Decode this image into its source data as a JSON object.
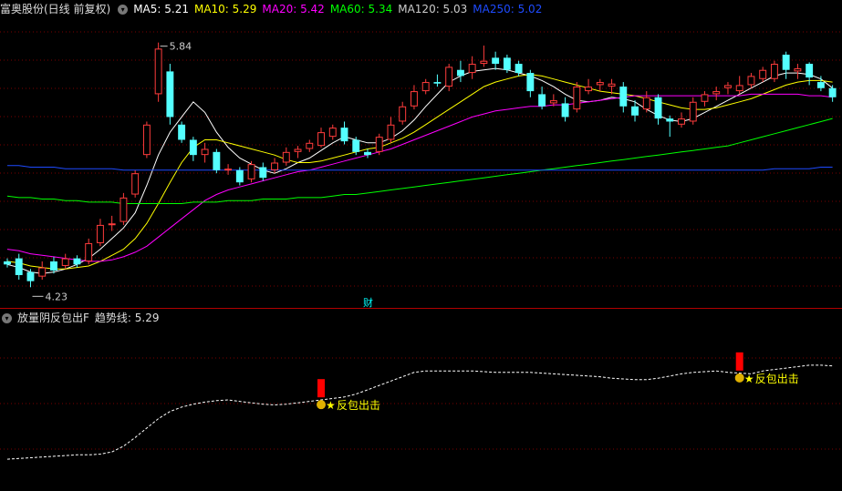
{
  "header": {
    "stock_title": "富奥股份(日线 前复权)",
    "ma_items": [
      {
        "label": "MA5: 5.21",
        "color": "#ffffff"
      },
      {
        "label": "MA10: 5.29",
        "color": "#ffff00"
      },
      {
        "label": "MA20: 5.42",
        "color": "#ff00ff"
      },
      {
        "label": "MA60: 5.34",
        "color": "#00ff00"
      },
      {
        "label": "MA120: 5.03",
        "color": "#cccccc"
      },
      {
        "label": "MA250: 5.02",
        "color": "#1e4bff"
      }
    ]
  },
  "indicator_header": {
    "title": "放量阴反包出F",
    "trend_label": "趋势线: 5.29"
  },
  "colors": {
    "up": "#ff3c3c",
    "down": "#54ffff",
    "grid": "#7a0000",
    "signal": "#ff0000",
    "signal_text": "#ffff00"
  },
  "chart_data": {
    "type": "candlestick",
    "ylim": [
      4.1,
      6.0
    ],
    "high_label": "5.84",
    "low_label": "4.23",
    "finance_marker": "财",
    "signal_text": "反包出击",
    "candles": [
      [
        4.4,
        4.38,
        4.42,
        4.36
      ],
      [
        4.42,
        4.31,
        4.45,
        4.28
      ],
      [
        4.33,
        4.27,
        4.35,
        4.23
      ],
      [
        4.3,
        4.36,
        4.4,
        4.28
      ],
      [
        4.4,
        4.34,
        4.43,
        4.32
      ],
      [
        4.37,
        4.42,
        4.45,
        4.35
      ],
      [
        4.42,
        4.38,
        4.44,
        4.36
      ],
      [
        4.4,
        4.52,
        4.55,
        4.38
      ],
      [
        4.52,
        4.64,
        4.68,
        4.5
      ],
      [
        4.64,
        4.65,
        4.7,
        4.6
      ],
      [
        4.66,
        4.82,
        4.85,
        4.64
      ],
      [
        4.84,
        4.98,
        5.0,
        4.82
      ],
      [
        5.1,
        5.3,
        5.32,
        5.08
      ],
      [
        5.5,
        5.8,
        5.84,
        5.45
      ],
      [
        5.65,
        5.35,
        5.7,
        5.3
      ],
      [
        5.3,
        5.2,
        5.32,
        5.18
      ],
      [
        5.2,
        5.1,
        5.22,
        5.06
      ],
      [
        5.1,
        5.14,
        5.18,
        5.05
      ],
      [
        5.12,
        5.0,
        5.14,
        4.98
      ],
      [
        5.0,
        5.01,
        5.04,
        4.97
      ],
      [
        5.0,
        4.92,
        5.02,
        4.9
      ],
      [
        4.94,
        5.04,
        5.06,
        4.92
      ],
      [
        5.02,
        4.95,
        5.05,
        4.93
      ],
      [
        5.0,
        5.05,
        5.08,
        4.98
      ],
      [
        5.05,
        5.12,
        5.15,
        5.03
      ],
      [
        5.12,
        5.14,
        5.16,
        5.08
      ],
      [
        5.14,
        5.18,
        5.2,
        5.12
      ],
      [
        5.16,
        5.25,
        5.28,
        5.15
      ],
      [
        5.22,
        5.28,
        5.3,
        5.2
      ],
      [
        5.28,
        5.19,
        5.32,
        5.17
      ],
      [
        5.2,
        5.12,
        5.22,
        5.1
      ],
      [
        5.12,
        5.1,
        5.14,
        5.08
      ],
      [
        5.12,
        5.22,
        5.24,
        5.1
      ],
      [
        5.2,
        5.3,
        5.35,
        5.18
      ],
      [
        5.32,
        5.42,
        5.45,
        5.3
      ],
      [
        5.42,
        5.52,
        5.56,
        5.4
      ],
      [
        5.52,
        5.58,
        5.6,
        5.5
      ],
      [
        5.58,
        5.57,
        5.63,
        5.55
      ],
      [
        5.55,
        5.68,
        5.7,
        5.52
      ],
      [
        5.66,
        5.62,
        5.72,
        5.58
      ],
      [
        5.64,
        5.7,
        5.75,
        5.6
      ],
      [
        5.7,
        5.72,
        5.82,
        5.68
      ],
      [
        5.74,
        5.7,
        5.78,
        5.66
      ],
      [
        5.74,
        5.66,
        5.76,
        5.64
      ],
      [
        5.7,
        5.64,
        5.72,
        5.62
      ],
      [
        5.64,
        5.52,
        5.66,
        5.48
      ],
      [
        5.5,
        5.42,
        5.55,
        5.4
      ],
      [
        5.44,
        5.46,
        5.5,
        5.42
      ],
      [
        5.44,
        5.35,
        5.48,
        5.32
      ],
      [
        5.4,
        5.55,
        5.58,
        5.38
      ],
      [
        5.52,
        5.55,
        5.6,
        5.5
      ],
      [
        5.56,
        5.58,
        5.6,
        5.52
      ],
      [
        5.55,
        5.57,
        5.6,
        5.5
      ],
      [
        5.55,
        5.42,
        5.58,
        5.38
      ],
      [
        5.42,
        5.36,
        5.46,
        5.32
      ],
      [
        5.4,
        5.48,
        5.52,
        5.38
      ],
      [
        5.48,
        5.34,
        5.5,
        5.3
      ],
      [
        5.34,
        5.32,
        5.36,
        5.22
      ],
      [
        5.3,
        5.34,
        5.38,
        5.28
      ],
      [
        5.32,
        5.45,
        5.48,
        5.3
      ],
      [
        5.45,
        5.5,
        5.52,
        5.42
      ],
      [
        5.5,
        5.52,
        5.55,
        5.46
      ],
      [
        5.54,
        5.56,
        5.58,
        5.5
      ],
      [
        5.52,
        5.56,
        5.62,
        5.5
      ],
      [
        5.56,
        5.62,
        5.64,
        5.54
      ],
      [
        5.6,
        5.66,
        5.68,
        5.58
      ],
      [
        5.6,
        5.7,
        5.72,
        5.58
      ],
      [
        5.76,
        5.66,
        5.78,
        5.6
      ],
      [
        5.65,
        5.67,
        5.7,
        5.6
      ],
      [
        5.7,
        5.61,
        5.71,
        5.56
      ],
      [
        5.58,
        5.54,
        5.62,
        5.52
      ],
      [
        5.54,
        5.48,
        5.56,
        5.45
      ]
    ],
    "ma_lines": [
      {
        "name": "MA5",
        "color": "#ffffff",
        "values": [
          4.38,
          4.36,
          4.33,
          4.32,
          4.33,
          4.35,
          4.38,
          4.42,
          4.48,
          4.55,
          4.62,
          4.72,
          4.9,
          5.1,
          5.25,
          5.35,
          5.45,
          5.38,
          5.25,
          5.15,
          5.08,
          5.04,
          5.0,
          4.98,
          5.01,
          5.05,
          5.08,
          5.13,
          5.18,
          5.22,
          5.2,
          5.18,
          5.18,
          5.21,
          5.26,
          5.33,
          5.42,
          5.5,
          5.58,
          5.62,
          5.65,
          5.66,
          5.67,
          5.66,
          5.64,
          5.62,
          5.59,
          5.55,
          5.5,
          5.46,
          5.45,
          5.46,
          5.48,
          5.47,
          5.45,
          5.4,
          5.36,
          5.33,
          5.32,
          5.34,
          5.38,
          5.42,
          5.46,
          5.5,
          5.54,
          5.58,
          5.62,
          5.64,
          5.64,
          5.63,
          5.6,
          5.54
        ]
      },
      {
        "name": "MA10",
        "color": "#ffff00",
        "values": [
          4.4,
          4.39,
          4.37,
          4.36,
          4.35,
          4.35,
          4.36,
          4.37,
          4.4,
          4.44,
          4.48,
          4.55,
          4.65,
          4.78,
          4.92,
          5.05,
          5.15,
          5.2,
          5.2,
          5.18,
          5.16,
          5.14,
          5.12,
          5.1,
          5.07,
          5.05,
          5.05,
          5.06,
          5.08,
          5.1,
          5.12,
          5.14,
          5.15,
          5.18,
          5.21,
          5.25,
          5.3,
          5.35,
          5.4,
          5.45,
          5.5,
          5.55,
          5.58,
          5.6,
          5.62,
          5.63,
          5.62,
          5.6,
          5.58,
          5.56,
          5.54,
          5.52,
          5.51,
          5.5,
          5.49,
          5.47,
          5.45,
          5.43,
          5.41,
          5.4,
          5.4,
          5.41,
          5.43,
          5.45,
          5.47,
          5.5,
          5.53,
          5.56,
          5.58,
          5.59,
          5.59,
          5.58
        ]
      },
      {
        "name": "MA20",
        "color": "#ff00ff",
        "values": [
          4.48,
          4.47,
          4.45,
          4.44,
          4.43,
          4.42,
          4.41,
          4.4,
          4.4,
          4.41,
          4.43,
          4.46,
          4.5,
          4.56,
          4.62,
          4.68,
          4.74,
          4.8,
          4.84,
          4.87,
          4.89,
          4.91,
          4.93,
          4.95,
          4.97,
          4.99,
          5.0,
          5.02,
          5.04,
          5.06,
          5.08,
          5.1,
          5.12,
          5.14,
          5.17,
          5.2,
          5.23,
          5.26,
          5.29,
          5.32,
          5.35,
          5.37,
          5.39,
          5.4,
          5.41,
          5.42,
          5.42,
          5.43,
          5.43,
          5.44,
          5.45,
          5.46,
          5.47,
          5.48,
          5.49,
          5.49,
          5.49,
          5.49,
          5.49,
          5.49,
          5.49,
          5.49,
          5.49,
          5.49,
          5.5,
          5.5,
          5.5,
          5.5,
          5.5,
          5.49,
          5.49,
          5.48
        ]
      },
      {
        "name": "MA60",
        "color": "#00ff00",
        "values": [
          4.83,
          4.82,
          4.82,
          4.81,
          4.81,
          4.8,
          4.8,
          4.79,
          4.79,
          4.79,
          4.78,
          4.78,
          4.78,
          4.78,
          4.78,
          4.78,
          4.79,
          4.79,
          4.79,
          4.8,
          4.8,
          4.8,
          4.81,
          4.81,
          4.81,
          4.82,
          4.82,
          4.82,
          4.83,
          4.84,
          4.84,
          4.85,
          4.86,
          4.87,
          4.88,
          4.89,
          4.9,
          4.91,
          4.92,
          4.93,
          4.94,
          4.95,
          4.96,
          4.97,
          4.98,
          4.99,
          5.0,
          5.01,
          5.02,
          5.03,
          5.04,
          5.05,
          5.06,
          5.07,
          5.08,
          5.09,
          5.1,
          5.11,
          5.12,
          5.13,
          5.14,
          5.15,
          5.16,
          5.18,
          5.2,
          5.22,
          5.24,
          5.26,
          5.28,
          5.3,
          5.32,
          5.34
        ]
      },
      {
        "name": "MA250",
        "color": "#1e4bff",
        "values": [
          5.03,
          5.03,
          5.02,
          5.02,
          5.02,
          5.01,
          5.01,
          5.01,
          5.01,
          5.01,
          5.0,
          5.0,
          5.0,
          5.0,
          5.0,
          5.0,
          5.0,
          5.0,
          5.0,
          5.0,
          5.0,
          5.0,
          5.0,
          5.0,
          5.0,
          5.0,
          5.0,
          5.0,
          5.0,
          5.0,
          5.0,
          5.0,
          5.0,
          5.0,
          5.0,
          5.0,
          5.0,
          5.0,
          5.0,
          5.0,
          5.0,
          5.0,
          5.0,
          5.0,
          5.0,
          5.0,
          5.0,
          5.0,
          5.0,
          5.0,
          5.0,
          5.0,
          5.0,
          5.0,
          5.0,
          5.0,
          5.0,
          5.0,
          5.0,
          5.0,
          5.0,
          5.0,
          5.0,
          5.0,
          5.0,
          5.0,
          5.01,
          5.01,
          5.01,
          5.01,
          5.02,
          5.02
        ]
      }
    ],
    "trend_line": {
      "name": "趋势线",
      "color": "#ffffff",
      "ylim": [
        4.3,
        5.9
      ],
      "values": [
        4.4,
        4.41,
        4.42,
        4.43,
        4.44,
        4.45,
        4.46,
        4.46,
        4.47,
        4.5,
        4.58,
        4.7,
        4.83,
        4.96,
        5.06,
        5.12,
        5.16,
        5.19,
        5.21,
        5.22,
        5.2,
        5.18,
        5.16,
        5.15,
        5.16,
        5.18,
        5.2,
        5.22,
        5.24,
        5.26,
        5.3,
        5.36,
        5.42,
        5.48,
        5.54,
        5.6,
        5.62,
        5.62,
        5.62,
        5.62,
        5.62,
        5.61,
        5.6,
        5.6,
        5.6,
        5.6,
        5.59,
        5.58,
        5.57,
        5.56,
        5.55,
        5.54,
        5.52,
        5.51,
        5.5,
        5.5,
        5.52,
        5.55,
        5.58,
        5.6,
        5.61,
        5.62,
        5.6,
        5.59,
        5.58,
        5.62,
        5.64,
        5.66,
        5.68,
        5.7,
        5.7,
        5.69
      ]
    },
    "signals": [
      {
        "index": 27,
        "value": 5.23
      },
      {
        "index": 63,
        "value": 5.6
      }
    ]
  }
}
